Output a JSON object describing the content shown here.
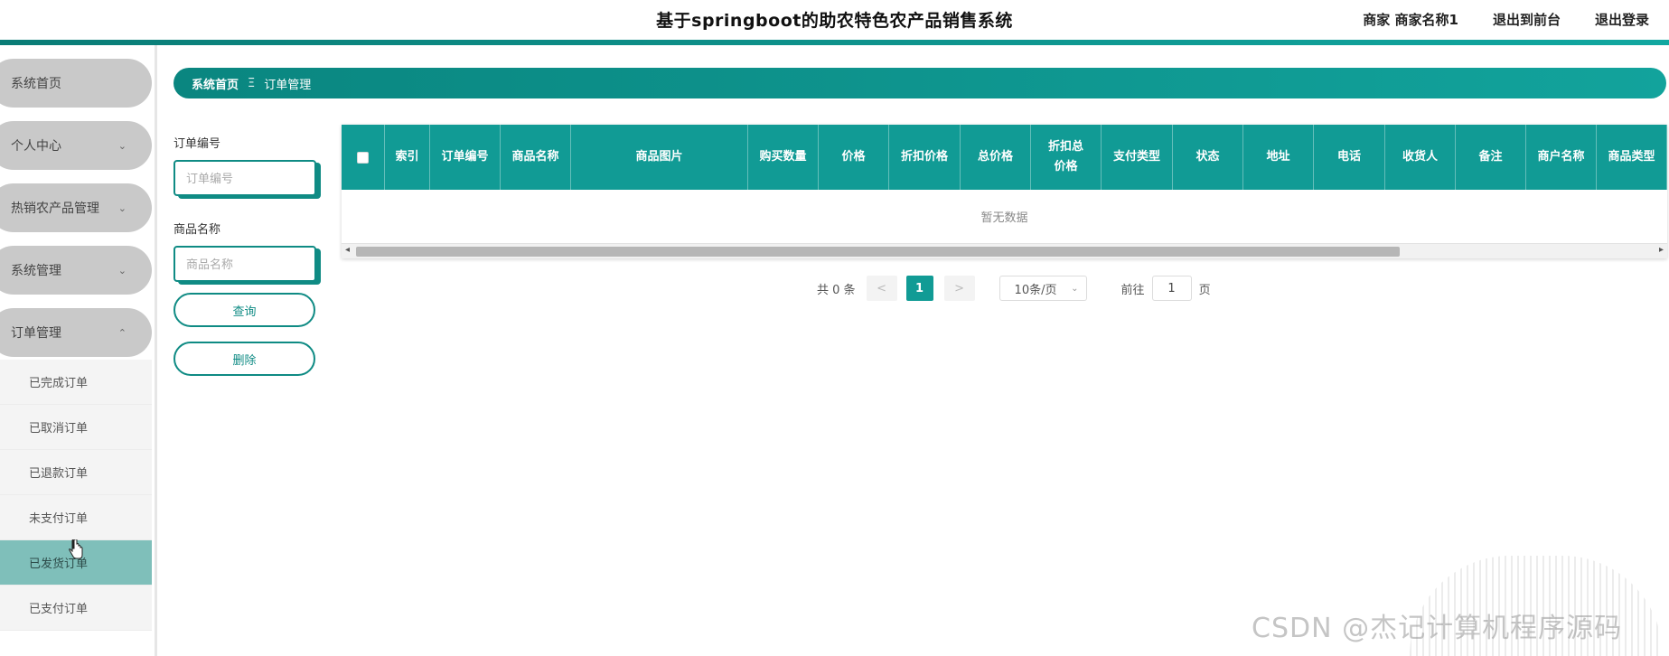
{
  "header": {
    "title": "基于springboot的助农特色农产品销售系统",
    "user": "商家 商家名称1",
    "back_front": "退出到前台",
    "logout": "退出登录"
  },
  "sidebar": {
    "items": [
      {
        "label": "系统首页",
        "has_arrow": false
      },
      {
        "label": "个人中心",
        "has_arrow": true
      },
      {
        "label": "热销农产品管理",
        "has_arrow": true
      },
      {
        "label": "系统管理",
        "has_arrow": true
      },
      {
        "label": "订单管理",
        "has_arrow": true,
        "expanded": true
      }
    ],
    "chev_down": "⌄",
    "chev_up": "⌃",
    "submenu": [
      {
        "label": "已完成订单"
      },
      {
        "label": "已取消订单"
      },
      {
        "label": "已退款订单"
      },
      {
        "label": "未支付订单"
      },
      {
        "label": "已发货订单",
        "active": true
      },
      {
        "label": "已支付订单"
      }
    ]
  },
  "breadcrumb": {
    "home": "系统首页",
    "separator": "Ξ",
    "current": "订单管理"
  },
  "search": {
    "order_no_label": "订单编号",
    "order_no_placeholder": "订单编号",
    "product_name_label": "商品名称",
    "product_name_placeholder": "商品名称",
    "query_button": "查询",
    "delete_button": "删除"
  },
  "table": {
    "columns": [
      "索引",
      "订单编号",
      "商品名称",
      "商品图片",
      "购买数量",
      "价格",
      "折扣价格",
      "总价格",
      "折扣总价格",
      "支付类型",
      "状态",
      "地址",
      "电话",
      "收货人",
      "备注",
      "商户名称",
      "商品类型"
    ],
    "empty_text": "暂无数据",
    "scroll_left": "◂",
    "scroll_right": "▸"
  },
  "pagination": {
    "total": "共 0 条",
    "prev": "<",
    "current_page": "1",
    "next": ">",
    "page_size": "10条/页",
    "goto_label": "前往",
    "goto_value": "1",
    "page_suffix": "页"
  },
  "watermark": "CSDN @杰记计算机程序源码",
  "colors": {
    "accent": "#119b95",
    "accent_dark": "#0a7c76",
    "menu_bg": "#c9c9c9",
    "submenu_active": "#7fbfba"
  }
}
